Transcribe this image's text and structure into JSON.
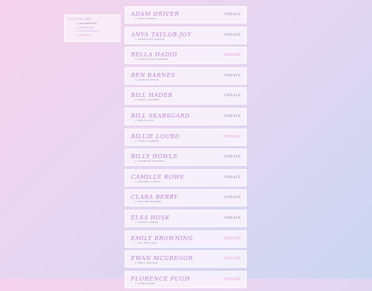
{
  "key": {
    "title": "ACTIVITY KEY",
    "items": [
      {
        "label": "— INCOMPLETE",
        "color": "#6d6591"
      },
      {
        "label": "— COMPLETE",
        "color": "#c887d6"
      },
      {
        "label": "— OUTSTANDING",
        "color": "#b48fd6"
      },
      {
        "label": "— PRIORITY",
        "color": "#e07fc8"
      }
    ]
  },
  "colors": {
    "name": "#b884cc",
    "sub": "#7d7193",
    "action_default": "#7d7193",
    "action_pink": "#e07fc8"
  },
  "cards": [
    {
      "name": "ADAM DRIVER",
      "sub": "// GRIS SCHMIT",
      "action": "UPDATE",
      "accent": false
    },
    {
      "name": "ANYA TAYLOR-JOY",
      "sub": "// PENELOPE GARVIE",
      "action": "UPDATE",
      "accent": false
    },
    {
      "name": "BELLA HADID",
      "sub": "// DOMINIQUE TAZZARI",
      "action": "UPDATE",
      "accent": true
    },
    {
      "name": "BEN BARNES",
      "sub": "// LIAM CLINTON",
      "action": "UPDATE",
      "accent": false
    },
    {
      "name": "BILL HADER",
      "sub": "// AXEL CASIMER",
      "action": "UPDATE",
      "accent": false
    },
    {
      "name": "BILL SKARSGARD",
      "sub": "// SIM TYLER",
      "action": "UPDATE",
      "accent": false
    },
    {
      "name": "BILLIE LOURD",
      "sub": "// TESSA FORBES",
      "action": "UPDATE",
      "accent": true
    },
    {
      "name": "BILLY HOWLE",
      "sub": "// CHARLIE CARTWIN",
      "action": "UPDATE",
      "accent": false
    },
    {
      "name": "CAMILLE ROWE",
      "sub": "// IMOGEN CARILL",
      "action": "UPDATE",
      "accent": false
    },
    {
      "name": "CLARA BERRY",
      "sub": "// PALOMA BAKERT",
      "action": "UPDATE",
      "accent": false
    },
    {
      "name": "ELSA HOSK",
      "sub": "// SABIEL JAMES",
      "action": "UPDATE",
      "accent": false
    },
    {
      "name": "EMILY BROWNING",
      "sub": "// IVY MULLADY",
      "action": "UPDATE",
      "accent": true
    },
    {
      "name": "EWAN MCGREGOR",
      "sub": "// RHYS MACKAY",
      "action": "UPDATE",
      "accent": true
    },
    {
      "name": "FLORENCE PUGH",
      "sub": "// LYDIA HART",
      "action": "UPDATE",
      "accent": true
    }
  ]
}
